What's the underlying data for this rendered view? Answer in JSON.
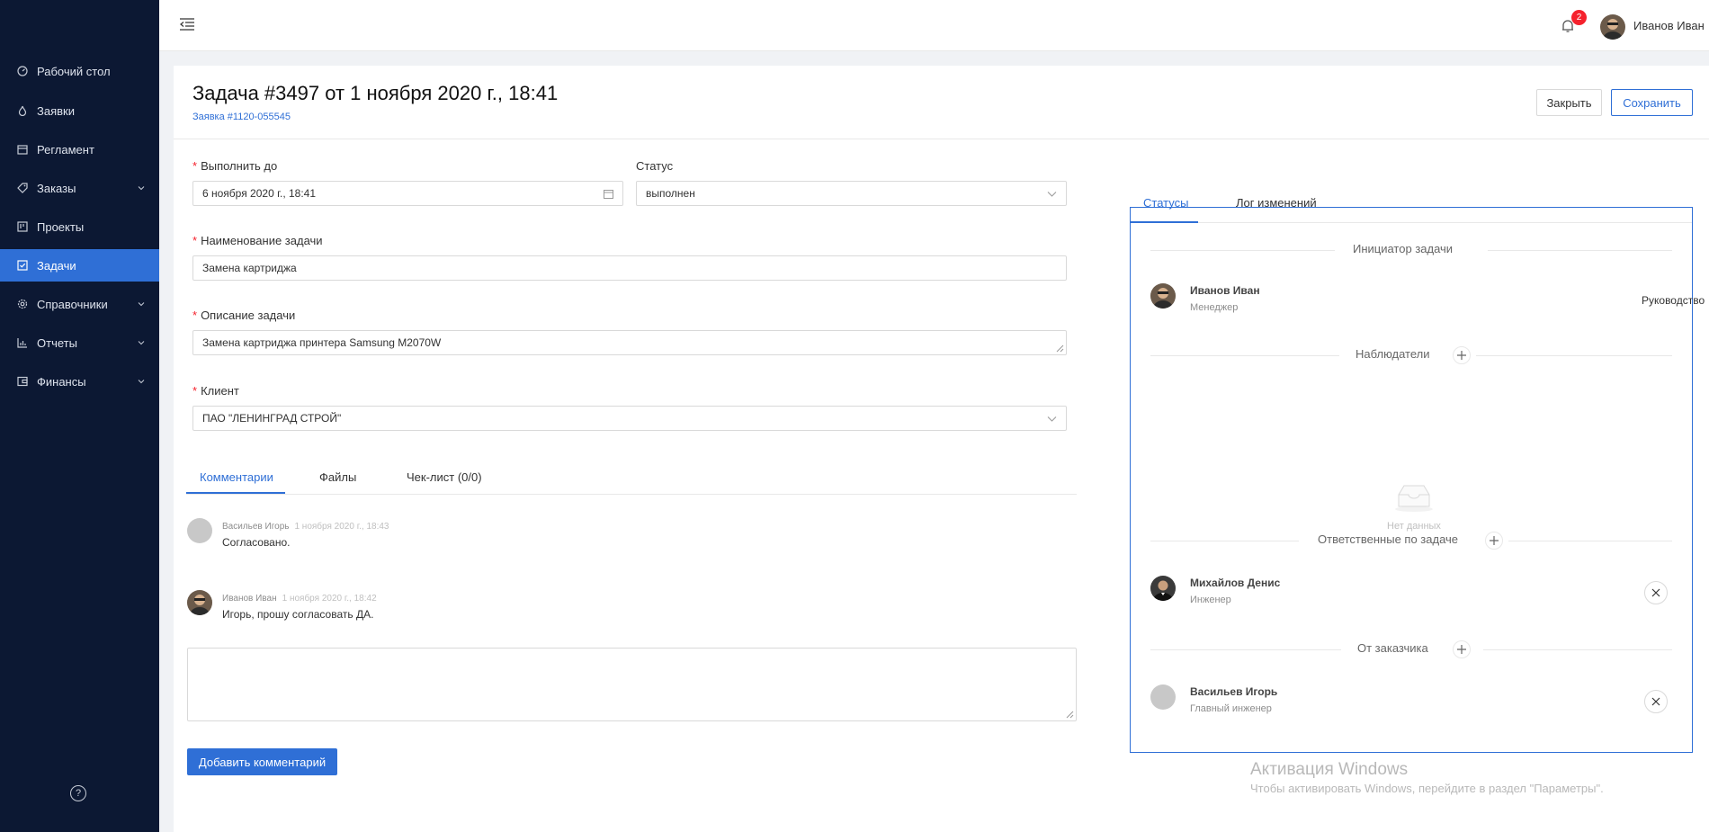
{
  "sidebar": {
    "items": [
      {
        "label": "Рабочий стол",
        "icon": "dashboard-icon",
        "has_submenu": false,
        "active": false
      },
      {
        "label": "Заявки",
        "icon": "fire-icon",
        "has_submenu": false,
        "active": false
      },
      {
        "label": "Регламент",
        "icon": "calendar-icon",
        "has_submenu": false,
        "active": false
      },
      {
        "label": "Заказы",
        "icon": "tag-icon",
        "has_submenu": true,
        "active": false
      },
      {
        "label": "Проекты",
        "icon": "project-icon",
        "has_submenu": false,
        "active": false
      },
      {
        "label": "Задачи",
        "icon": "check-square-icon",
        "has_submenu": false,
        "active": true
      },
      {
        "label": "Справочники",
        "icon": "gear-icon",
        "has_submenu": true,
        "active": false
      },
      {
        "label": "Отчеты",
        "icon": "bar-chart-icon",
        "has_submenu": true,
        "active": false
      },
      {
        "label": "Финансы",
        "icon": "wallet-icon",
        "has_submenu": true,
        "active": false
      }
    ],
    "help_glyph": "?"
  },
  "header": {
    "notifications_count": "2",
    "user_name": "Иванов Иван"
  },
  "page": {
    "title": "Задача #3497 от 1 ноября 2020 г., 18:41",
    "request_link": "Заявка #1120-055545",
    "close_label": "Закрыть",
    "save_label": "Сохранить"
  },
  "form": {
    "deadline_label": "Выполнить до",
    "deadline_value": "6 ноября 2020 г., 18:41",
    "status_label": "Статус",
    "status_value": "выполнен",
    "name_label": "Наименование задачи",
    "name_value": "Замена картриджа",
    "description_label": "Описание задачи",
    "description_value": "Замена картриджа принтера Samsung M2070W",
    "client_label": "Клиент",
    "client_value": "ПАО \"ЛЕНИНГРАД СТРОЙ\"",
    "required_mark": "*"
  },
  "tabs": [
    {
      "label": "Комментарии",
      "active": true
    },
    {
      "label": "Файлы",
      "active": false
    },
    {
      "label": "Чек-лист (0/0)",
      "active": false
    }
  ],
  "comments": [
    {
      "author": "Васильев Игорь",
      "time": "1 ноября 2020 г., 18:43",
      "text": "Согласовано.",
      "has_photo": false
    },
    {
      "author": "Иванов Иван",
      "time": "1 ноября 2020 г., 18:42",
      "text": "Игорь, прошу согласовать ДА.",
      "has_photo": true
    }
  ],
  "add_comment_label": "Добавить комментарий",
  "right_tabs": [
    {
      "label": "Статусы",
      "active": true
    },
    {
      "label": "Лог изменений",
      "active": false
    }
  ],
  "panel": {
    "initiator_title": "Инициатор задачи",
    "initiator": {
      "name": "Иванов Иван",
      "role": "Менеджер",
      "dept": "Руководство"
    },
    "observers_title": "Наблюдатели",
    "empty_text": "Нет данных",
    "responsible_title": "Ответственные по задаче",
    "responsible": {
      "name": "Михайлов Денис",
      "role": "Инженер"
    },
    "customer_title": "От заказчика",
    "customer": {
      "name": "Васильев Игорь",
      "role": "Главный инженер"
    }
  },
  "watermark": {
    "line1": "Активация Windows",
    "line2": "Чтобы активировать Windows, перейдите в раздел \"Параметры\"."
  },
  "colors": {
    "sidebar_bg": "#0c1833",
    "accent": "#2f6fd6",
    "badge": "#f5222d"
  }
}
